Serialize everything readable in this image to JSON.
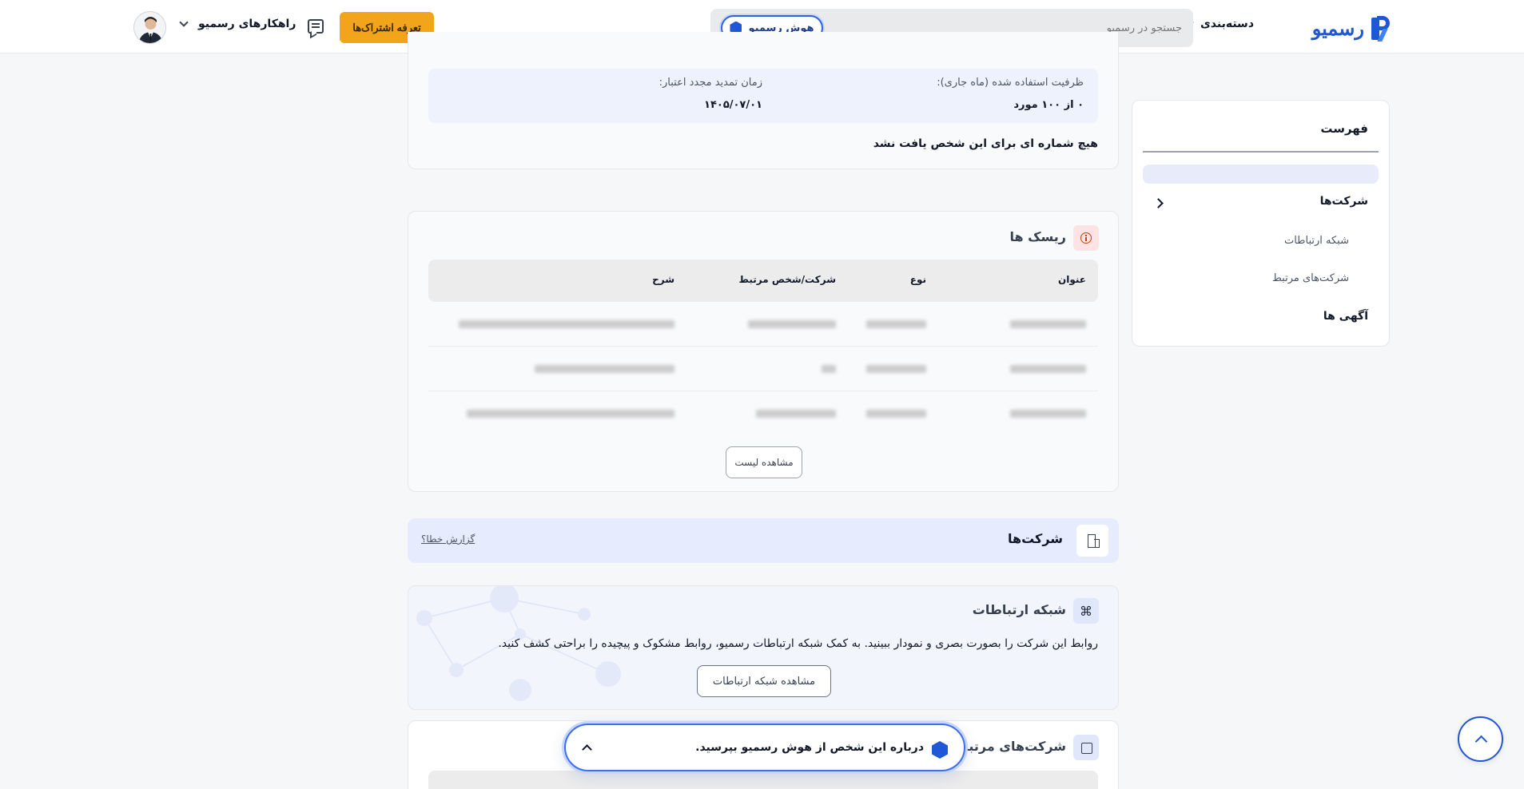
{
  "header": {
    "logo_text": "رسمیو",
    "category_label": "دسته‌بندی",
    "search_placeholder": "جستجو در رسمیو",
    "ai_button_label": "هوش رسمیو",
    "subscription_button_label": "تعرفه اشتراک‌ها",
    "solutions_label": "راهکارهای رسمیو"
  },
  "toc": {
    "title": "فهرست",
    "items": [
      {
        "label": "شرکت‌ها",
        "level": "main"
      },
      {
        "label": "شبکه ارتباطات",
        "level": "sub"
      },
      {
        "label": "شرکت‌های مرتبط",
        "level": "sub"
      },
      {
        "label": "آگهی ها",
        "level": "main"
      }
    ]
  },
  "phones_card": {
    "used_capacity_label": "ظرفیت استفاده شده (ماه جاری):",
    "used_capacity_value": "۰ از ۱۰۰ مورد",
    "renewal_label": "زمان تمدید مجدد اعتبار:",
    "renewal_value": "۱۴۰۵/۰۷/۰۱",
    "no_number_message": "هیچ شماره ای برای این شخص یافت نشد"
  },
  "risks": {
    "title": "ریسک ها",
    "columns": [
      "عنوان",
      "نوع",
      "شرکت/شخص مرتبط",
      "شرح"
    ],
    "row_count": 3,
    "view_list_label": "مشاهده لیست"
  },
  "companies": {
    "title": "شرکت‌ها",
    "report_error_label": "گزارش خطا؟"
  },
  "network": {
    "title": "شبکه ارتباطات",
    "description": "روابط این شرکت را بصورت بصری و نمودار ببینید. به کمک شبکه ارتباطات رسمیو، روابط مشکوک و پیچیده را براحتی کشف کنید.",
    "button_label": "مشاهده شبکه ارتباطات"
  },
  "related": {
    "title": "شرکت‌های مرتبط"
  },
  "ask_bar": {
    "text": "درباره این شخص از هوش رسمیو بپرسید."
  },
  "colors": {
    "brand": "#1f57d6",
    "accent_orange": "#f2a51a"
  }
}
